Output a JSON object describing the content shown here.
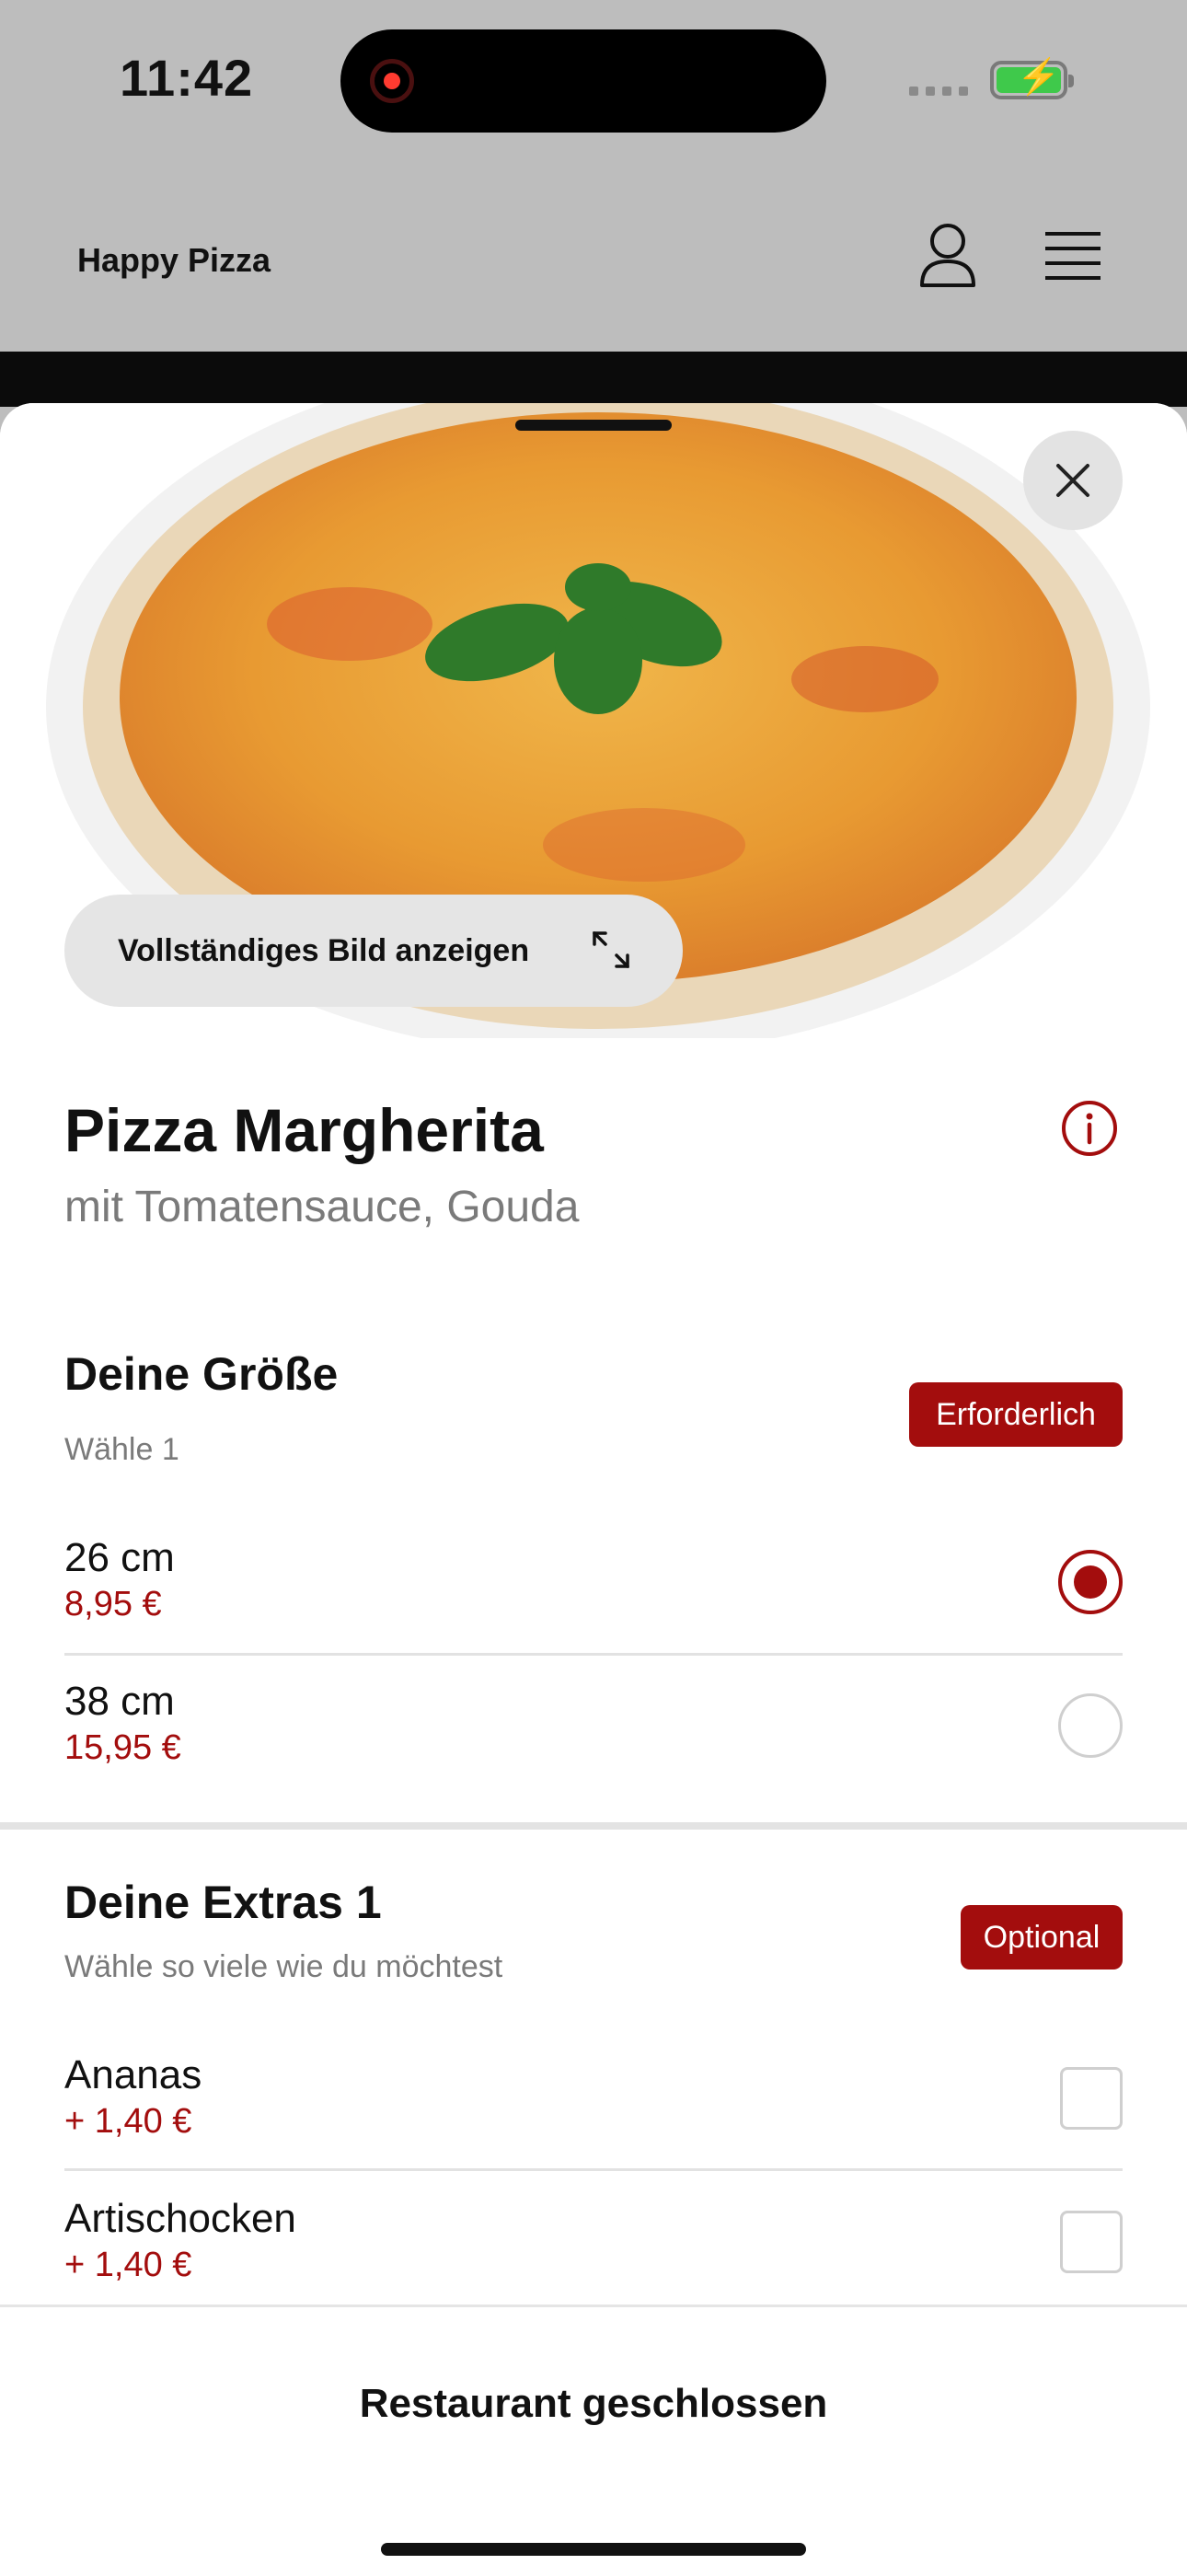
{
  "status_bar": {
    "time": "11:42"
  },
  "header": {
    "brand": "Happy Pizza"
  },
  "product": {
    "full_image_button": "Vollständiges Bild anzeigen",
    "name": "Pizza Margherita",
    "description": "mit Tomatensauce, Gouda"
  },
  "size_section": {
    "title": "Deine Größe",
    "subtitle": "Wähle 1",
    "badge": "Erforderlich",
    "options": [
      {
        "name": "26 cm",
        "price": "8,95 €",
        "selected": true
      },
      {
        "name": "38 cm",
        "price": "15,95 €",
        "selected": false
      }
    ]
  },
  "extras_section": {
    "title": "Deine Extras 1",
    "subtitle": "Wähle so viele wie du möchtest",
    "badge": "Optional",
    "options": [
      {
        "name": "Ananas",
        "price": "+ 1,40 €",
        "checked": false
      },
      {
        "name": "Artischocken",
        "price": "+ 1,40 €",
        "checked": false
      }
    ]
  },
  "footer": {
    "status": "Restaurant geschlossen"
  },
  "colors": {
    "accent": "#a30d0d",
    "header_bg": "#bdbdbd"
  },
  "icons": [
    "record-icon",
    "battery-icon",
    "user-icon",
    "menu-icon",
    "close-icon",
    "expand-icon",
    "info-icon"
  ]
}
